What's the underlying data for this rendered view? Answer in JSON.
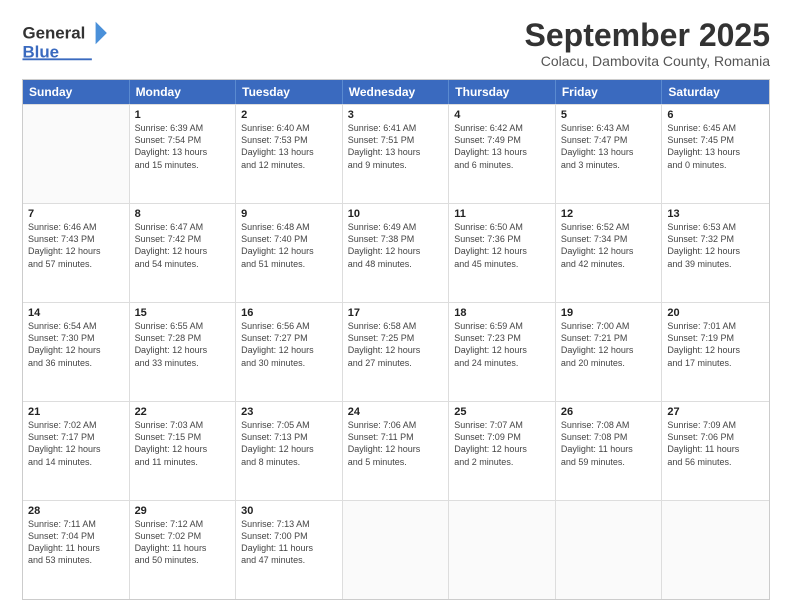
{
  "header": {
    "logo": {
      "line1": "General",
      "line2": "Blue",
      "arrow": "▶"
    },
    "title": "September 2025",
    "subtitle": "Colacu, Dambovita County, Romania"
  },
  "weekdays": [
    "Sunday",
    "Monday",
    "Tuesday",
    "Wednesday",
    "Thursday",
    "Friday",
    "Saturday"
  ],
  "rows": [
    [
      {
        "day": "",
        "lines": []
      },
      {
        "day": "1",
        "lines": [
          "Sunrise: 6:39 AM",
          "Sunset: 7:54 PM",
          "Daylight: 13 hours",
          "and 15 minutes."
        ]
      },
      {
        "day": "2",
        "lines": [
          "Sunrise: 6:40 AM",
          "Sunset: 7:53 PM",
          "Daylight: 13 hours",
          "and 12 minutes."
        ]
      },
      {
        "day": "3",
        "lines": [
          "Sunrise: 6:41 AM",
          "Sunset: 7:51 PM",
          "Daylight: 13 hours",
          "and 9 minutes."
        ]
      },
      {
        "day": "4",
        "lines": [
          "Sunrise: 6:42 AM",
          "Sunset: 7:49 PM",
          "Daylight: 13 hours",
          "and 6 minutes."
        ]
      },
      {
        "day": "5",
        "lines": [
          "Sunrise: 6:43 AM",
          "Sunset: 7:47 PM",
          "Daylight: 13 hours",
          "and 3 minutes."
        ]
      },
      {
        "day": "6",
        "lines": [
          "Sunrise: 6:45 AM",
          "Sunset: 7:45 PM",
          "Daylight: 13 hours",
          "and 0 minutes."
        ]
      }
    ],
    [
      {
        "day": "7",
        "lines": [
          "Sunrise: 6:46 AM",
          "Sunset: 7:43 PM",
          "Daylight: 12 hours",
          "and 57 minutes."
        ]
      },
      {
        "day": "8",
        "lines": [
          "Sunrise: 6:47 AM",
          "Sunset: 7:42 PM",
          "Daylight: 12 hours",
          "and 54 minutes."
        ]
      },
      {
        "day": "9",
        "lines": [
          "Sunrise: 6:48 AM",
          "Sunset: 7:40 PM",
          "Daylight: 12 hours",
          "and 51 minutes."
        ]
      },
      {
        "day": "10",
        "lines": [
          "Sunrise: 6:49 AM",
          "Sunset: 7:38 PM",
          "Daylight: 12 hours",
          "and 48 minutes."
        ]
      },
      {
        "day": "11",
        "lines": [
          "Sunrise: 6:50 AM",
          "Sunset: 7:36 PM",
          "Daylight: 12 hours",
          "and 45 minutes."
        ]
      },
      {
        "day": "12",
        "lines": [
          "Sunrise: 6:52 AM",
          "Sunset: 7:34 PM",
          "Daylight: 12 hours",
          "and 42 minutes."
        ]
      },
      {
        "day": "13",
        "lines": [
          "Sunrise: 6:53 AM",
          "Sunset: 7:32 PM",
          "Daylight: 12 hours",
          "and 39 minutes."
        ]
      }
    ],
    [
      {
        "day": "14",
        "lines": [
          "Sunrise: 6:54 AM",
          "Sunset: 7:30 PM",
          "Daylight: 12 hours",
          "and 36 minutes."
        ]
      },
      {
        "day": "15",
        "lines": [
          "Sunrise: 6:55 AM",
          "Sunset: 7:28 PM",
          "Daylight: 12 hours",
          "and 33 minutes."
        ]
      },
      {
        "day": "16",
        "lines": [
          "Sunrise: 6:56 AM",
          "Sunset: 7:27 PM",
          "Daylight: 12 hours",
          "and 30 minutes."
        ]
      },
      {
        "day": "17",
        "lines": [
          "Sunrise: 6:58 AM",
          "Sunset: 7:25 PM",
          "Daylight: 12 hours",
          "and 27 minutes."
        ]
      },
      {
        "day": "18",
        "lines": [
          "Sunrise: 6:59 AM",
          "Sunset: 7:23 PM",
          "Daylight: 12 hours",
          "and 24 minutes."
        ]
      },
      {
        "day": "19",
        "lines": [
          "Sunrise: 7:00 AM",
          "Sunset: 7:21 PM",
          "Daylight: 12 hours",
          "and 20 minutes."
        ]
      },
      {
        "day": "20",
        "lines": [
          "Sunrise: 7:01 AM",
          "Sunset: 7:19 PM",
          "Daylight: 12 hours",
          "and 17 minutes."
        ]
      }
    ],
    [
      {
        "day": "21",
        "lines": [
          "Sunrise: 7:02 AM",
          "Sunset: 7:17 PM",
          "Daylight: 12 hours",
          "and 14 minutes."
        ]
      },
      {
        "day": "22",
        "lines": [
          "Sunrise: 7:03 AM",
          "Sunset: 7:15 PM",
          "Daylight: 12 hours",
          "and 11 minutes."
        ]
      },
      {
        "day": "23",
        "lines": [
          "Sunrise: 7:05 AM",
          "Sunset: 7:13 PM",
          "Daylight: 12 hours",
          "and 8 minutes."
        ]
      },
      {
        "day": "24",
        "lines": [
          "Sunrise: 7:06 AM",
          "Sunset: 7:11 PM",
          "Daylight: 12 hours",
          "and 5 minutes."
        ]
      },
      {
        "day": "25",
        "lines": [
          "Sunrise: 7:07 AM",
          "Sunset: 7:09 PM",
          "Daylight: 12 hours",
          "and 2 minutes."
        ]
      },
      {
        "day": "26",
        "lines": [
          "Sunrise: 7:08 AM",
          "Sunset: 7:08 PM",
          "Daylight: 11 hours",
          "and 59 minutes."
        ]
      },
      {
        "day": "27",
        "lines": [
          "Sunrise: 7:09 AM",
          "Sunset: 7:06 PM",
          "Daylight: 11 hours",
          "and 56 minutes."
        ]
      }
    ],
    [
      {
        "day": "28",
        "lines": [
          "Sunrise: 7:11 AM",
          "Sunset: 7:04 PM",
          "Daylight: 11 hours",
          "and 53 minutes."
        ]
      },
      {
        "day": "29",
        "lines": [
          "Sunrise: 7:12 AM",
          "Sunset: 7:02 PM",
          "Daylight: 11 hours",
          "and 50 minutes."
        ]
      },
      {
        "day": "30",
        "lines": [
          "Sunrise: 7:13 AM",
          "Sunset: 7:00 PM",
          "Daylight: 11 hours",
          "and 47 minutes."
        ]
      },
      {
        "day": "",
        "lines": []
      },
      {
        "day": "",
        "lines": []
      },
      {
        "day": "",
        "lines": []
      },
      {
        "day": "",
        "lines": []
      }
    ]
  ]
}
